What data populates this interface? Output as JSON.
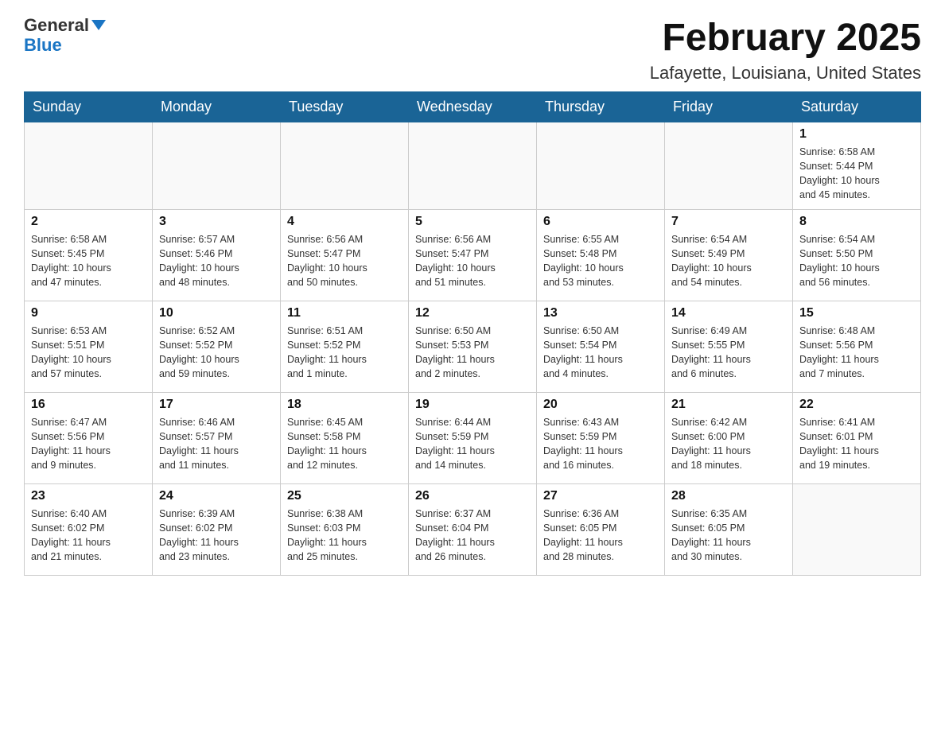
{
  "logo": {
    "line1": "General",
    "arrow": true,
    "line2": "Blue"
  },
  "title": "February 2025",
  "subtitle": "Lafayette, Louisiana, United States",
  "weekdays": [
    "Sunday",
    "Monday",
    "Tuesday",
    "Wednesday",
    "Thursday",
    "Friday",
    "Saturday"
  ],
  "weeks": [
    [
      {
        "day": "",
        "info": ""
      },
      {
        "day": "",
        "info": ""
      },
      {
        "day": "",
        "info": ""
      },
      {
        "day": "",
        "info": ""
      },
      {
        "day": "",
        "info": ""
      },
      {
        "day": "",
        "info": ""
      },
      {
        "day": "1",
        "info": "Sunrise: 6:58 AM\nSunset: 5:44 PM\nDaylight: 10 hours\nand 45 minutes."
      }
    ],
    [
      {
        "day": "2",
        "info": "Sunrise: 6:58 AM\nSunset: 5:45 PM\nDaylight: 10 hours\nand 47 minutes."
      },
      {
        "day": "3",
        "info": "Sunrise: 6:57 AM\nSunset: 5:46 PM\nDaylight: 10 hours\nand 48 minutes."
      },
      {
        "day": "4",
        "info": "Sunrise: 6:56 AM\nSunset: 5:47 PM\nDaylight: 10 hours\nand 50 minutes."
      },
      {
        "day": "5",
        "info": "Sunrise: 6:56 AM\nSunset: 5:47 PM\nDaylight: 10 hours\nand 51 minutes."
      },
      {
        "day": "6",
        "info": "Sunrise: 6:55 AM\nSunset: 5:48 PM\nDaylight: 10 hours\nand 53 minutes."
      },
      {
        "day": "7",
        "info": "Sunrise: 6:54 AM\nSunset: 5:49 PM\nDaylight: 10 hours\nand 54 minutes."
      },
      {
        "day": "8",
        "info": "Sunrise: 6:54 AM\nSunset: 5:50 PM\nDaylight: 10 hours\nand 56 minutes."
      }
    ],
    [
      {
        "day": "9",
        "info": "Sunrise: 6:53 AM\nSunset: 5:51 PM\nDaylight: 10 hours\nand 57 minutes."
      },
      {
        "day": "10",
        "info": "Sunrise: 6:52 AM\nSunset: 5:52 PM\nDaylight: 10 hours\nand 59 minutes."
      },
      {
        "day": "11",
        "info": "Sunrise: 6:51 AM\nSunset: 5:52 PM\nDaylight: 11 hours\nand 1 minute."
      },
      {
        "day": "12",
        "info": "Sunrise: 6:50 AM\nSunset: 5:53 PM\nDaylight: 11 hours\nand 2 minutes."
      },
      {
        "day": "13",
        "info": "Sunrise: 6:50 AM\nSunset: 5:54 PM\nDaylight: 11 hours\nand 4 minutes."
      },
      {
        "day": "14",
        "info": "Sunrise: 6:49 AM\nSunset: 5:55 PM\nDaylight: 11 hours\nand 6 minutes."
      },
      {
        "day": "15",
        "info": "Sunrise: 6:48 AM\nSunset: 5:56 PM\nDaylight: 11 hours\nand 7 minutes."
      }
    ],
    [
      {
        "day": "16",
        "info": "Sunrise: 6:47 AM\nSunset: 5:56 PM\nDaylight: 11 hours\nand 9 minutes."
      },
      {
        "day": "17",
        "info": "Sunrise: 6:46 AM\nSunset: 5:57 PM\nDaylight: 11 hours\nand 11 minutes."
      },
      {
        "day": "18",
        "info": "Sunrise: 6:45 AM\nSunset: 5:58 PM\nDaylight: 11 hours\nand 12 minutes."
      },
      {
        "day": "19",
        "info": "Sunrise: 6:44 AM\nSunset: 5:59 PM\nDaylight: 11 hours\nand 14 minutes."
      },
      {
        "day": "20",
        "info": "Sunrise: 6:43 AM\nSunset: 5:59 PM\nDaylight: 11 hours\nand 16 minutes."
      },
      {
        "day": "21",
        "info": "Sunrise: 6:42 AM\nSunset: 6:00 PM\nDaylight: 11 hours\nand 18 minutes."
      },
      {
        "day": "22",
        "info": "Sunrise: 6:41 AM\nSunset: 6:01 PM\nDaylight: 11 hours\nand 19 minutes."
      }
    ],
    [
      {
        "day": "23",
        "info": "Sunrise: 6:40 AM\nSunset: 6:02 PM\nDaylight: 11 hours\nand 21 minutes."
      },
      {
        "day": "24",
        "info": "Sunrise: 6:39 AM\nSunset: 6:02 PM\nDaylight: 11 hours\nand 23 minutes."
      },
      {
        "day": "25",
        "info": "Sunrise: 6:38 AM\nSunset: 6:03 PM\nDaylight: 11 hours\nand 25 minutes."
      },
      {
        "day": "26",
        "info": "Sunrise: 6:37 AM\nSunset: 6:04 PM\nDaylight: 11 hours\nand 26 minutes."
      },
      {
        "day": "27",
        "info": "Sunrise: 6:36 AM\nSunset: 6:05 PM\nDaylight: 11 hours\nand 28 minutes."
      },
      {
        "day": "28",
        "info": "Sunrise: 6:35 AM\nSunset: 6:05 PM\nDaylight: 11 hours\nand 30 minutes."
      },
      {
        "day": "",
        "info": ""
      }
    ]
  ]
}
